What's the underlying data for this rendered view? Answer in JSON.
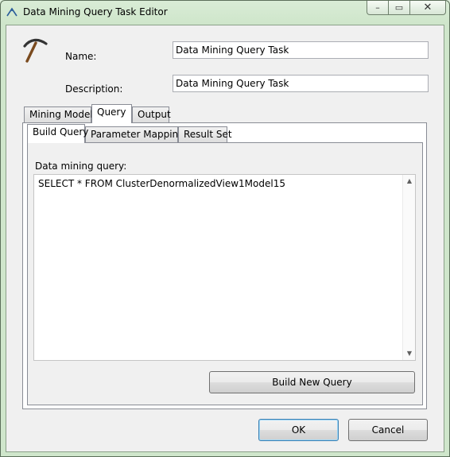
{
  "window": {
    "title": "Data Mining Query Task Editor",
    "controls": {
      "minimize": "–",
      "maximize": "▭",
      "close": "✕"
    }
  },
  "form": {
    "name_label": "Name:",
    "name_value": "Data Mining Query Task",
    "description_label": "Description:",
    "description_value": "Data Mining Query Task"
  },
  "tabs": [
    {
      "label": "Mining Model",
      "active": false
    },
    {
      "label": "Query",
      "active": true
    },
    {
      "label": "Output",
      "active": false
    }
  ],
  "subtabs": [
    {
      "label": "Build Query",
      "active": true
    },
    {
      "label": "Parameter Mapping",
      "active": false
    },
    {
      "label": "Result Set",
      "active": false
    }
  ],
  "query": {
    "label": "Data mining query:",
    "text": "SELECT * FROM ClusterDenormalizedView1Model15"
  },
  "buttons": {
    "build_new_query": "Build New Query",
    "ok": "OK",
    "cancel": "Cancel"
  },
  "colors": {
    "window_frame": "#cfe6cb",
    "default_button_border": "#3c7fb1"
  }
}
